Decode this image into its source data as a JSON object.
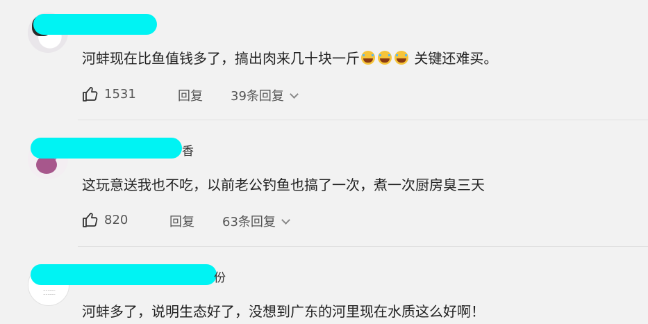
{
  "comments": [
    {
      "name_tail": "",
      "text": "河蚌现在比鱼值钱多了，搞出肉来几十块一斤",
      "emojis": [
        "crying-face-icon",
        "crying-face-icon",
        "crying-face-icon"
      ],
      "text_after": " 关键还难买。",
      "likes": "1531",
      "reply_label": "回复",
      "replies_label": "39条回复"
    },
    {
      "name_tail": "香",
      "text": "这玩意送我也不吃，以前老公钓鱼也搞了一次，煮一次厨房臭三天",
      "likes": "820",
      "reply_label": "回复",
      "replies_label": "63条回复"
    },
    {
      "name_tail": "份",
      "text": "河蚌多了，说明生态好了，没想到广东的河里现在水质这么好啊！"
    }
  ]
}
